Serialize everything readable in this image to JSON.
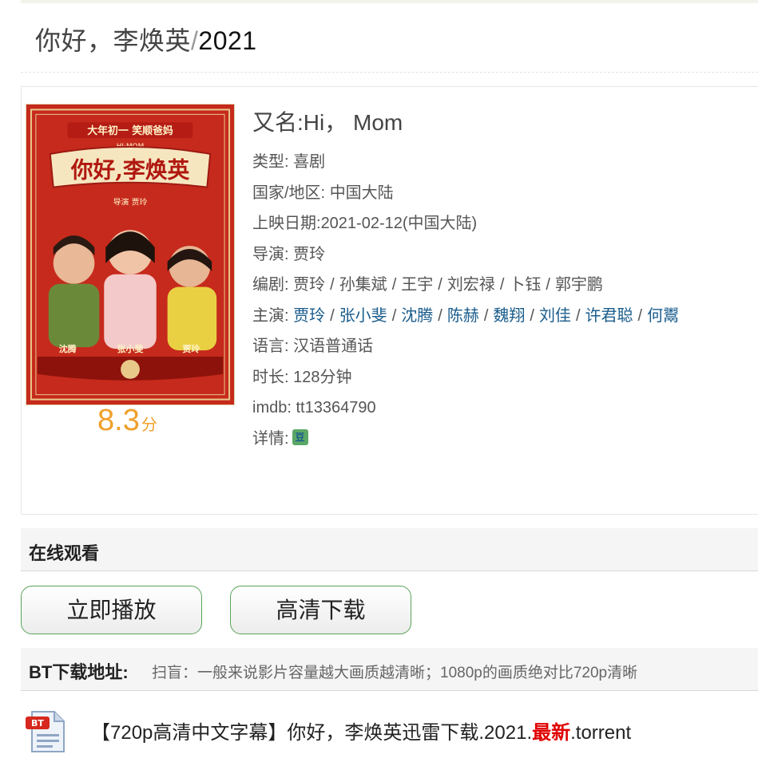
{
  "page": {
    "title_main": "你好，李焕英",
    "title_slash": "/",
    "title_year": "2021"
  },
  "movie": {
    "alias_label": "又名:",
    "alias_value": "Hi， Mom",
    "score": "8.3",
    "score_unit": "分",
    "fields": {
      "genre_label": "类型:",
      "genre": "喜剧",
      "region_label": "国家/地区:",
      "region": "中国大陆",
      "release_label": "上映日期:",
      "release": "2021-02-12(中国大陆)",
      "director_label": "导演:",
      "director": "贾玲",
      "writers_label": "编剧:",
      "writers": [
        "贾玲",
        "孙集斌",
        "王宇",
        "刘宏禄",
        "卜钰",
        "郭宇鹏"
      ],
      "cast_label": "主演:",
      "cast": [
        "贾玲",
        "张小斐",
        "沈腾",
        "陈赫",
        "魏翔",
        "刘佳",
        "许君聪",
        "何鬻"
      ],
      "language_label": "语言:",
      "language": "汉语普通话",
      "duration_label": "时长:",
      "duration": "128分钟",
      "imdb_label": "imdb:",
      "imdb": "tt13364790",
      "details_label": "详情:"
    },
    "poster": {
      "top_banner": "大年初一  笑顺爸妈",
      "subtitle": "HI·MOM",
      "logo_text": "你好,李焕英",
      "credit": "导演  贾玲",
      "names": [
        "沈腾",
        "张小斐",
        "贾玲"
      ]
    }
  },
  "online": {
    "section_title": "在线观看",
    "play_button": "立即播放",
    "hd_button": "高清下载"
  },
  "bt": {
    "section_title": "BT下载地址:",
    "hint": "扫盲：一般来说影片容量越大画质越清晰；1080p的画质绝对比720p清晰",
    "file_prefix": "【720p高清中文字幕】你好，李焕英迅雷下载.2021.",
    "file_new": "最新",
    "file_suffix": ".torrent",
    "file_icon_label": "BT"
  },
  "colors": {
    "score": "#f0a02a",
    "link": "#1a5c8c",
    "new_tag": "#e00000",
    "button_border": "#5aa35a"
  }
}
